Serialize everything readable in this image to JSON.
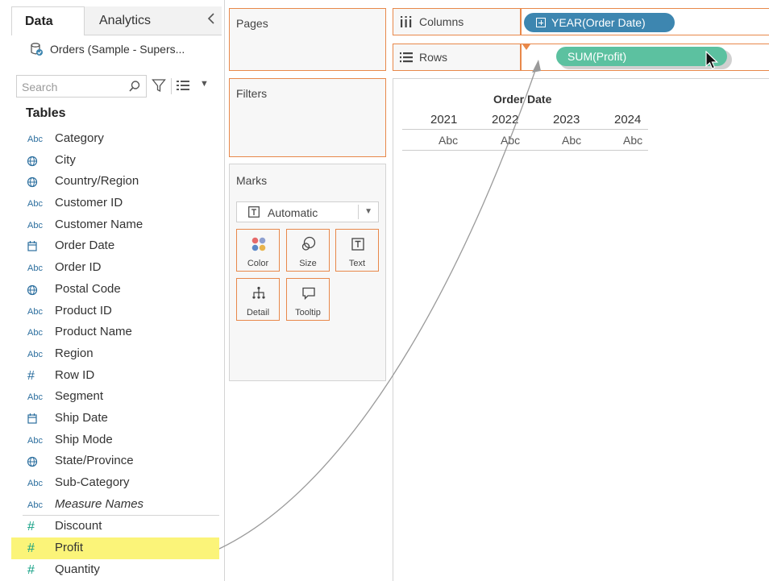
{
  "data_pane": {
    "tabs": {
      "data": "Data",
      "analytics": "Analytics"
    },
    "collapse_icon": "chevron-left-icon",
    "datasource": "Orders (Sample - Supers...",
    "search": {
      "placeholder": "Search"
    },
    "tables_heading": "Tables",
    "dimensions": [
      {
        "name": "Category",
        "type": "Abc"
      },
      {
        "name": "City",
        "type": "globe"
      },
      {
        "name": "Country/Region",
        "type": "globe"
      },
      {
        "name": "Customer ID",
        "type": "Abc"
      },
      {
        "name": "Customer Name",
        "type": "Abc"
      },
      {
        "name": "Order Date",
        "type": "calendar"
      },
      {
        "name": "Order ID",
        "type": "Abc"
      },
      {
        "name": "Postal Code",
        "type": "globe"
      },
      {
        "name": "Product ID",
        "type": "Abc"
      },
      {
        "name": "Product Name",
        "type": "Abc"
      },
      {
        "name": "Region",
        "type": "Abc"
      },
      {
        "name": "Row ID",
        "type": "#"
      },
      {
        "name": "Segment",
        "type": "Abc"
      },
      {
        "name": "Ship Date",
        "type": "calendar"
      },
      {
        "name": "Ship Mode",
        "type": "Abc"
      },
      {
        "name": "State/Province",
        "type": "globe"
      },
      {
        "name": "Sub-Category",
        "type": "Abc"
      },
      {
        "name": "Measure Names",
        "type": "Abc"
      }
    ],
    "measures": [
      {
        "name": "Discount",
        "type": "#"
      },
      {
        "name": "Profit",
        "type": "#"
      },
      {
        "name": "Quantity",
        "type": "#"
      }
    ],
    "highlighted_field": "Profit",
    "highlight_color": "#fbf479"
  },
  "shelves": {
    "pages": "Pages",
    "filters": "Filters",
    "columns_label": "Columns",
    "rows_label": "Rows",
    "columns_pill": "YEAR(Order Date)",
    "rows_pill": "SUM(Profit)"
  },
  "marks": {
    "title": "Marks",
    "type": "Automatic",
    "buttons": {
      "color": "Color",
      "size": "Size",
      "text": "Text",
      "detail": "Detail",
      "tooltip": "Tooltip"
    }
  },
  "view": {
    "header": "Order Date",
    "years": [
      "2021",
      "2022",
      "2023",
      "2024"
    ],
    "cells": [
      "Abc",
      "Abc",
      "Abc",
      "Abc"
    ]
  },
  "colors": {
    "shelf_border": "#e8884a",
    "dimension_pill": "#3d86b0",
    "measure_pill": "#5cc1a0",
    "dimension_icon": "#2b6e9e",
    "measure_icon": "#14a085"
  }
}
